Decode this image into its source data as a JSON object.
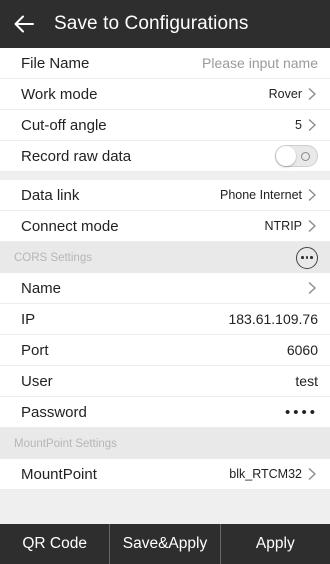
{
  "header": {
    "title": "Save to Configurations"
  },
  "rows1": {
    "file_name": {
      "label": "File Name",
      "placeholder": "Please input name"
    },
    "work_mode": {
      "label": "Work mode",
      "value": "Rover"
    },
    "cutoff": {
      "label": "Cut-off angle",
      "value": "5"
    },
    "record_raw": {
      "label": "Record raw data",
      "enabled": false
    }
  },
  "rows2": {
    "data_link": {
      "label": "Data link",
      "value": "Phone Internet"
    },
    "connect_mode": {
      "label": "Connect mode",
      "value": "NTRIP"
    }
  },
  "cors": {
    "title": "CORS Settings",
    "name": {
      "label": "Name",
      "value": ""
    },
    "ip": {
      "label": "IP",
      "value": "183.61.109.76"
    },
    "port": {
      "label": "Port",
      "value": "6060"
    },
    "user": {
      "label": "User",
      "value": "test"
    },
    "password": {
      "label": "Password",
      "value": "••••"
    }
  },
  "mountpoint": {
    "title": "MountPoint Settings",
    "row": {
      "label": "MountPoint",
      "value": "blk_RTCM32"
    }
  },
  "footer": {
    "qr": "QR Code",
    "save_apply": "Save&Apply",
    "apply": "Apply"
  },
  "colors": {
    "header_bg": "#2e2e2e",
    "section_bg": "#e9e9e9",
    "page_bg": "#efefef"
  },
  "icons": {
    "back": "arrow-left-icon",
    "chevron": "chevron-right-icon",
    "more": "more-horizontal-icon"
  }
}
